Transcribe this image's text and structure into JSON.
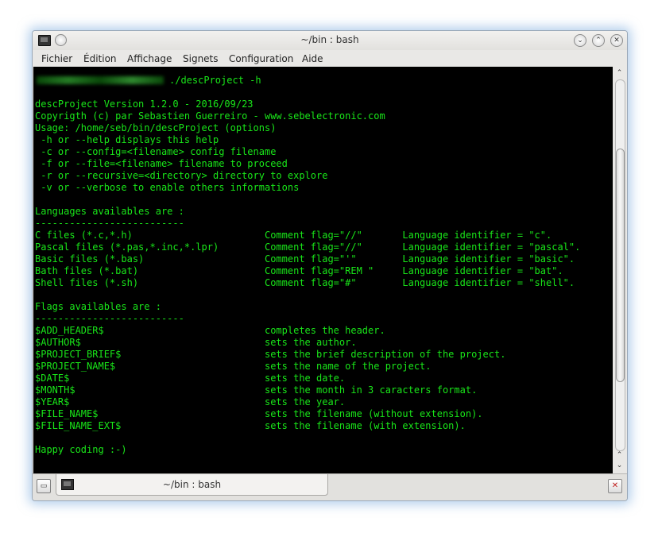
{
  "window": {
    "title": "~/bin : bash"
  },
  "menu": [
    "Fichier",
    "Édition",
    "Affichage",
    "Signets",
    "Configuration",
    "Aide"
  ],
  "terminal": {
    "prompt_command": "./descProject -h",
    "lines": [
      "descProject Version 1.2.0 - 2016/09/23",
      "Copyrigth (c) par Sebastien Guerreiro - www.sebelectronic.com",
      "Usage: /home/seb/bin/descProject (options)",
      " -h or --help displays this help",
      " -c or --config=<filename> config filename",
      " -f or --file=<filename> filename to proceed",
      " -r or --recursive=<directory> directory to explore",
      " -v or --verbose to enable others informations",
      "",
      "Languages availables are :",
      "--------------------------",
      "C files (*.c,*.h)                       Comment flag=\"//\"       Language identifier = \"c\".",
      "Pascal files (*.pas,*.inc,*.lpr)        Comment flag=\"//\"       Language identifier = \"pascal\".",
      "Basic files (*.bas)                     Comment flag=\"'\"        Language identifier = \"basic\".",
      "Bath files (*.bat)                      Comment flag=\"REM \"     Language identifier = \"bat\".",
      "Shell files (*.sh)                      Comment flag=\"#\"        Language identifier = \"shell\".",
      "",
      "Flags availables are :",
      "--------------------------",
      "$ADD_HEADER$                            completes the header.",
      "$AUTHOR$                                sets the author.",
      "$PROJECT_BRIEF$                         sets the brief description of the project.",
      "$PROJECT_NAME$                          sets the name of the project.",
      "$DATE$                                  sets the date.",
      "$MONTH$                                 sets the month in 3 caracters format.",
      "$YEAR$                                  sets the year.",
      "$FILE_NAME$                             sets the filename (without extension).",
      "$FILE_NAME_EXT$                         sets the filename (with extension).",
      "",
      "Happy coding :-)"
    ],
    "text_color": "#19e619",
    "background": "#000000"
  },
  "tabs": [
    {
      "label": "~/bin : bash"
    }
  ],
  "icons": {
    "window_icon": "terminal-icon",
    "pin": "pin-icon",
    "minimize": "minimize-icon",
    "maximize": "maximize-icon",
    "close": "close-icon",
    "new_tab": "new-tab-icon",
    "close_tab": "close-tab-icon"
  }
}
